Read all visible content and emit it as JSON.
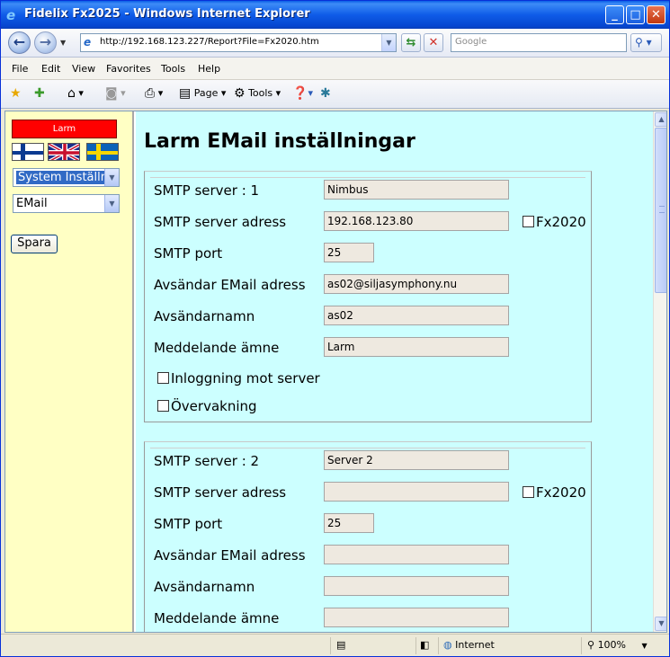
{
  "window": {
    "title": "Fidelix Fx2025 - Windows Internet Explorer",
    "minimize": "_",
    "maximize": "□",
    "close": "✕"
  },
  "address_bar": {
    "url": "http://192.168.123.227/Report?File=Fx2020.htm",
    "search_placeholder": "Google",
    "search_button": "⚲ ▾"
  },
  "menu": [
    "File",
    "Edit",
    "View",
    "Favorites",
    "Tools",
    "Help"
  ],
  "command_bar": {
    "page_label": "Page",
    "tools_label": "Tools"
  },
  "left_frame": {
    "alarm_button": "Larm",
    "flags": [
      "finland-flag",
      "uk-flag",
      "sweden-flag"
    ],
    "menu_select": "System Inställn.",
    "submenu_select": "EMail",
    "save_button": "Spara"
  },
  "main": {
    "title": "Larm EMail inställningar",
    "servers": [
      {
        "server_label": "SMTP server : 1",
        "server_name": "Nimbus",
        "address_label": "SMTP server adress",
        "address": "192.168.123.80",
        "fx2020_label": "Fx2020",
        "fx2020_checked": false,
        "port_label": "SMTP port",
        "port": "25",
        "sender_email_label": "Avsändar EMail adress",
        "sender_email": "as02@siljasymphony.nu",
        "sender_name_label": "Avsändarnamn",
        "sender_name": "as02",
        "subject_label": "Meddelande ämne",
        "subject": "Larm",
        "login_label": "Inloggning mot server",
        "login_checked": false,
        "monitoring_label": "Övervakning",
        "monitoring_checked": false
      },
      {
        "server_label": "SMTP server : 2",
        "server_name": "Server 2",
        "address_label": "SMTP server adress",
        "address": "",
        "fx2020_label": "Fx2020",
        "fx2020_checked": false,
        "port_label": "SMTP port",
        "port": "25",
        "sender_email_label": "Avsändar EMail adress",
        "sender_email": "",
        "sender_name_label": "Avsändarnamn",
        "sender_name": "",
        "subject_label": "Meddelande ämne",
        "subject": ""
      }
    ]
  },
  "status_bar": {
    "zone": "Internet",
    "zoom": "100%"
  }
}
